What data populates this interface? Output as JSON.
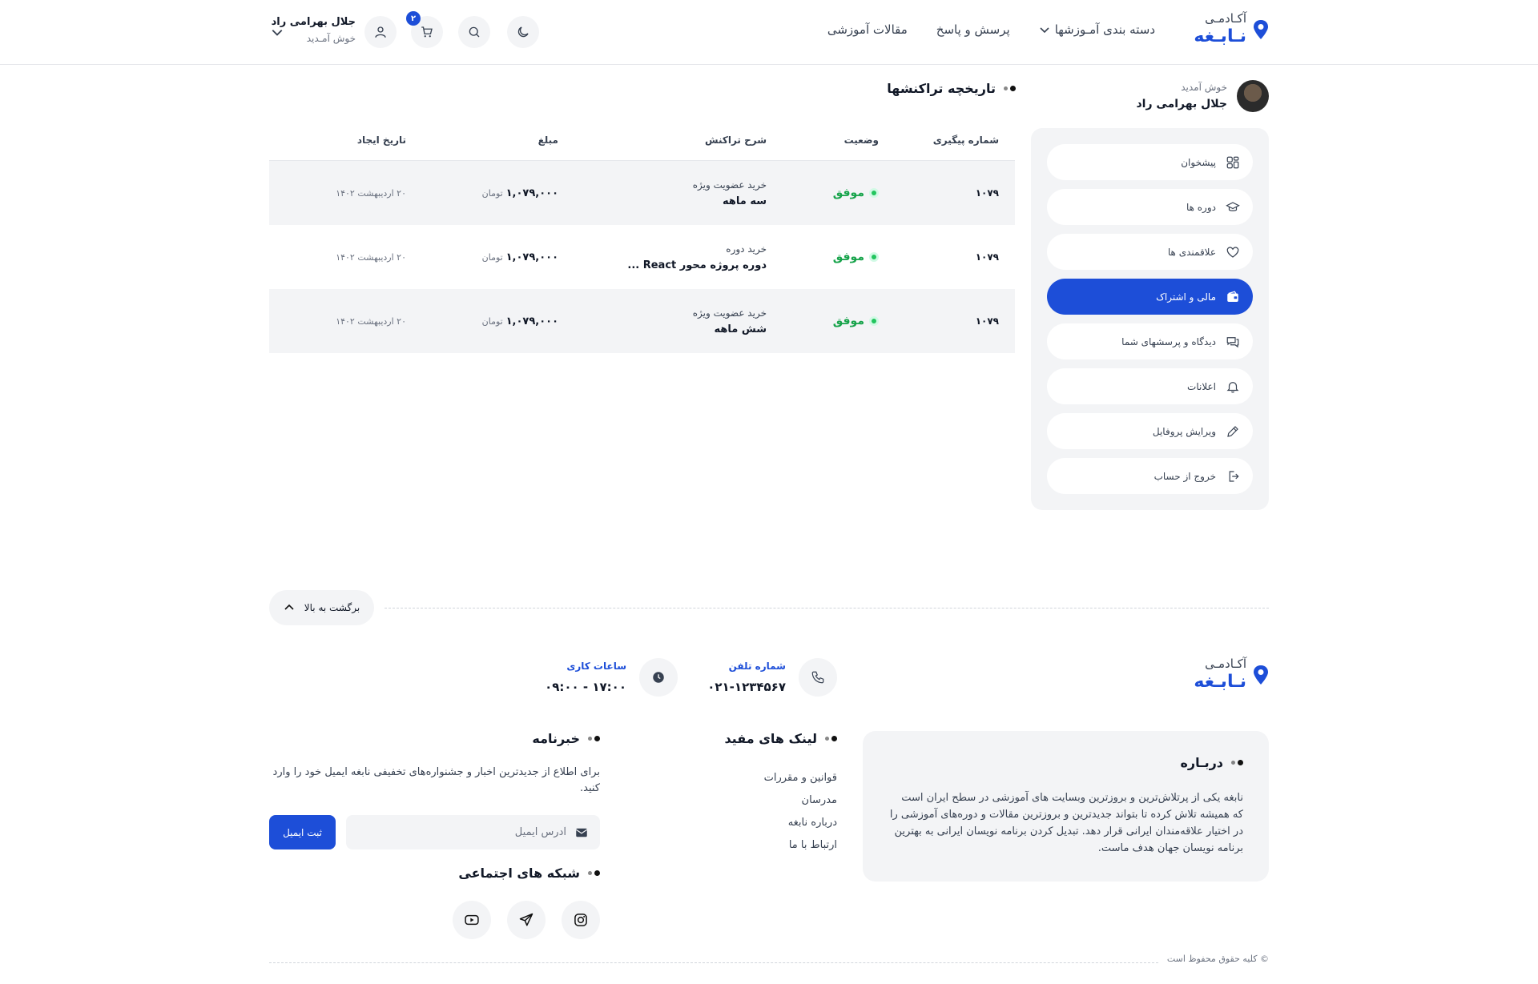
{
  "brand": {
    "small": "آکـادمـی",
    "big": "نـابـغه"
  },
  "nav": {
    "categories": "دسته بندی آمـوزشها",
    "qa": "پرسش و پاسخ",
    "articles": "مقالات آموزشی"
  },
  "header_user": {
    "name": "جلال بهرامی راد",
    "welcome": "خوش آمـدید"
  },
  "cart": {
    "count": "۲"
  },
  "profile": {
    "welcome": "خوش آمدید",
    "name": "جلال بهرامی راد"
  },
  "sidebar": {
    "items": [
      {
        "label": "پیشخوان",
        "icon": "dashboard-icon"
      },
      {
        "label": "دوره ها",
        "icon": "graduation-cap-icon"
      },
      {
        "label": "علاقمندی ها",
        "icon": "heart-icon"
      },
      {
        "label": "مالی و اشتراک",
        "icon": "wallet-icon"
      },
      {
        "label": "دیدگاه و پرسشهای شما",
        "icon": "chat-icon"
      },
      {
        "label": "اعلانات",
        "icon": "bell-icon"
      },
      {
        "label": "ویرایش پروفایل",
        "icon": "pencil-icon"
      },
      {
        "label": "خروج از حساب",
        "icon": "logout-icon"
      }
    ]
  },
  "transactions": {
    "title": "تاریخچه تراکنشها",
    "columns": [
      "شماره پیگیری",
      "وضعیت",
      "شرح تراکنش",
      "مبلغ",
      "تاریخ ایجاد"
    ],
    "rows": [
      {
        "id": "۱۰۷۹",
        "status": "موفق",
        "desc_small": "خرید عضویت ویژه",
        "desc_bold": "سه ماهه",
        "amount": "۱,۰۷۹,۰۰۰",
        "currency": "تومان",
        "date": "۲۰ اردیبهشت ۱۴۰۲"
      },
      {
        "id": "۱۰۷۹",
        "status": "موفق",
        "desc_small": "خرید دوره",
        "desc_bold": "دوره پروژه محور React ...",
        "amount": "۱,۰۷۹,۰۰۰",
        "currency": "تومان",
        "date": "۲۰ اردیبهشت ۱۴۰۲"
      },
      {
        "id": "۱۰۷۹",
        "status": "موفق",
        "desc_small": "خرید عضویت ویژه",
        "desc_bold": "شش ماهه",
        "amount": "۱,۰۷۹,۰۰۰",
        "currency": "تومان",
        "date": "۲۰ اردیبهشت ۱۴۰۲"
      }
    ]
  },
  "footer": {
    "back_to_top": "برگشت به بالا",
    "phone": {
      "label": "شماره تلفن",
      "value": "۰۲۱-۱۲۳۴۵۶۷"
    },
    "hours": {
      "label": "ساعات کاری",
      "value": "۰۹:۰۰ - ۱۷:۰۰"
    },
    "about": {
      "title": "دربـاره",
      "text": "نابغه یکی از پرتلاش‌ترین و بروزترین وبسایت های آموزشی در سطح ایران است که همیشه تلاش کرده تا بتواند جدیدترین و بروزترین مقالات و دوره‌های آموزشی را در اختیار علاقه‌مندان ایرانی قرار دهد. تبدیل کردن برنامه نویسان ایرانی به بهترین برنامه نویسان جهان هدف ماست."
    },
    "links": {
      "title": "لینک های مفید",
      "items": [
        "قوانین و مقررات",
        "مدرسان",
        "درباره نابغه",
        "ارتباط با ما"
      ]
    },
    "newsletter": {
      "title": "خبرنامه",
      "text": "برای اطلاع از جدیدترین اخبار و جشنواره‌های تخفیفی نابغه ایمیل خود را وارد کنید.",
      "placeholder": "آدرس ایمیل",
      "button": "ثبت ایمیل"
    },
    "social": {
      "title": "شبکه های اجتماعی"
    },
    "copyright": "© کلیه حقوق محفوظ است"
  },
  "colors": {
    "primary": "#1d4ed8",
    "success": "#16a34a",
    "surface": "#f3f4f6"
  }
}
